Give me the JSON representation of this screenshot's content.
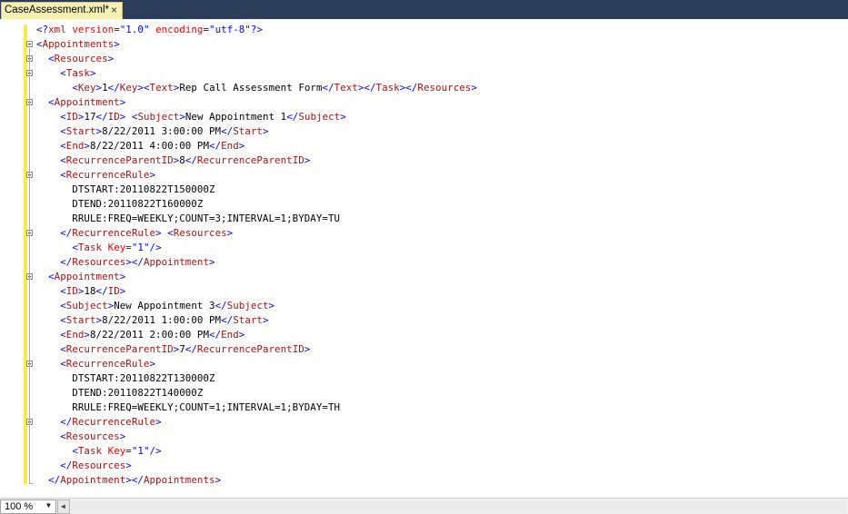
{
  "tab": {
    "title": "CaseAssessment.xml*",
    "close_glyph": "×"
  },
  "status": {
    "zoom": "100 %"
  },
  "icons": {
    "zoom_dropdown": "chevron-down-icon",
    "scroll_left": "scroll-left-icon",
    "tab_close": "close-icon"
  },
  "colors": {
    "tag": "#a31515",
    "delimiter": "#0000ff",
    "attribute": "#ff0000",
    "value": "#0000ff",
    "changed": "#ffe94d",
    "tab_strip": "#2b3c59",
    "active_tab": "#f7f0b5"
  },
  "lines": [
    [
      [
        "d",
        "<?"
      ],
      [
        "t",
        "xml"
      ],
      [
        "x",
        " "
      ],
      [
        "a",
        "version"
      ],
      [
        "d",
        "=\""
      ],
      [
        "v",
        "1.0"
      ],
      [
        "d",
        "\""
      ],
      [
        "x",
        " "
      ],
      [
        "a",
        "encoding"
      ],
      [
        "d",
        "=\""
      ],
      [
        "v",
        "utf-8"
      ],
      [
        "d",
        "\"?>"
      ]
    ],
    [
      [
        "d",
        "<"
      ],
      [
        "t",
        "Appointments"
      ],
      [
        "d",
        ">"
      ]
    ],
    [
      [
        "x",
        "  "
      ],
      [
        "d",
        "<"
      ],
      [
        "t",
        "Resources"
      ],
      [
        "d",
        ">"
      ]
    ],
    [
      [
        "x",
        "    "
      ],
      [
        "d",
        "<"
      ],
      [
        "t",
        "Task"
      ],
      [
        "d",
        ">"
      ]
    ],
    [
      [
        "x",
        "      "
      ],
      [
        "d",
        "<"
      ],
      [
        "t",
        "Key"
      ],
      [
        "d",
        ">"
      ],
      [
        "x",
        "1"
      ],
      [
        "d",
        "</"
      ],
      [
        "t",
        "Key"
      ],
      [
        "d",
        ">"
      ],
      [
        "d",
        "<"
      ],
      [
        "t",
        "Text"
      ],
      [
        "d",
        ">"
      ],
      [
        "x",
        "Rep Call Assessment Form"
      ],
      [
        "d",
        "</"
      ],
      [
        "t",
        "Text"
      ],
      [
        "d",
        ">"
      ],
      [
        "d",
        "</"
      ],
      [
        "t",
        "Task"
      ],
      [
        "d",
        ">"
      ],
      [
        "d",
        "</"
      ],
      [
        "t",
        "Resources"
      ],
      [
        "d",
        ">"
      ]
    ],
    [
      [
        "x",
        "  "
      ],
      [
        "d",
        "<"
      ],
      [
        "t",
        "Appointment"
      ],
      [
        "d",
        ">"
      ]
    ],
    [
      [
        "x",
        "    "
      ],
      [
        "d",
        "<"
      ],
      [
        "t",
        "ID"
      ],
      [
        "d",
        ">"
      ],
      [
        "x",
        "17"
      ],
      [
        "d",
        "</"
      ],
      [
        "t",
        "ID"
      ],
      [
        "d",
        ">"
      ],
      [
        "x",
        " "
      ],
      [
        "d",
        "<"
      ],
      [
        "t",
        "Subject"
      ],
      [
        "d",
        ">"
      ],
      [
        "x",
        "New Appointment 1"
      ],
      [
        "d",
        "</"
      ],
      [
        "t",
        "Subject"
      ],
      [
        "d",
        ">"
      ]
    ],
    [
      [
        "x",
        "    "
      ],
      [
        "d",
        "<"
      ],
      [
        "t",
        "Start"
      ],
      [
        "d",
        ">"
      ],
      [
        "x",
        "8/22/2011 3:00:00 PM"
      ],
      [
        "d",
        "</"
      ],
      [
        "t",
        "Start"
      ],
      [
        "d",
        ">"
      ]
    ],
    [
      [
        "x",
        "    "
      ],
      [
        "d",
        "<"
      ],
      [
        "t",
        "End"
      ],
      [
        "d",
        ">"
      ],
      [
        "x",
        "8/22/2011 4:00:00 PM"
      ],
      [
        "d",
        "</"
      ],
      [
        "t",
        "End"
      ],
      [
        "d",
        ">"
      ]
    ],
    [
      [
        "x",
        "    "
      ],
      [
        "d",
        "<"
      ],
      [
        "t",
        "RecurrenceParentID"
      ],
      [
        "d",
        ">"
      ],
      [
        "x",
        "8"
      ],
      [
        "d",
        "</"
      ],
      [
        "t",
        "RecurrenceParentID"
      ],
      [
        "d",
        ">"
      ]
    ],
    [
      [
        "x",
        "    "
      ],
      [
        "d",
        "<"
      ],
      [
        "t",
        "RecurrenceRule"
      ],
      [
        "d",
        ">"
      ]
    ],
    [
      [
        "x",
        "      DTSTART:20110822T150000Z"
      ]
    ],
    [
      [
        "x",
        "      DTEND:20110822T160000Z"
      ]
    ],
    [
      [
        "x",
        "      RRULE:FREQ=WEEKLY;COUNT=3;INTERVAL=1;BYDAY=TU"
      ]
    ],
    [
      [
        "x",
        "    "
      ],
      [
        "d",
        "</"
      ],
      [
        "t",
        "RecurrenceRule"
      ],
      [
        "d",
        ">"
      ],
      [
        "x",
        " "
      ],
      [
        "d",
        "<"
      ],
      [
        "t",
        "Resources"
      ],
      [
        "d",
        ">"
      ]
    ],
    [
      [
        "x",
        "      "
      ],
      [
        "d",
        "<"
      ],
      [
        "t",
        "Task"
      ],
      [
        "x",
        " "
      ],
      [
        "a",
        "Key"
      ],
      [
        "d",
        "=\""
      ],
      [
        "v",
        "1"
      ],
      [
        "d",
        "\"/>"
      ]
    ],
    [
      [
        "x",
        "    "
      ],
      [
        "d",
        "</"
      ],
      [
        "t",
        "Resources"
      ],
      [
        "d",
        ">"
      ],
      [
        "d",
        "</"
      ],
      [
        "t",
        "Appointment"
      ],
      [
        "d",
        ">"
      ]
    ],
    [
      [
        "x",
        "  "
      ],
      [
        "d",
        "<"
      ],
      [
        "t",
        "Appointment"
      ],
      [
        "d",
        ">"
      ]
    ],
    [
      [
        "x",
        "    "
      ],
      [
        "d",
        "<"
      ],
      [
        "t",
        "ID"
      ],
      [
        "d",
        ">"
      ],
      [
        "x",
        "18"
      ],
      [
        "d",
        "</"
      ],
      [
        "t",
        "ID"
      ],
      [
        "d",
        ">"
      ]
    ],
    [
      [
        "x",
        "    "
      ],
      [
        "d",
        "<"
      ],
      [
        "t",
        "Subject"
      ],
      [
        "d",
        ">"
      ],
      [
        "x",
        "New Appointment 3"
      ],
      [
        "d",
        "</"
      ],
      [
        "t",
        "Subject"
      ],
      [
        "d",
        ">"
      ]
    ],
    [
      [
        "x",
        "    "
      ],
      [
        "d",
        "<"
      ],
      [
        "t",
        "Start"
      ],
      [
        "d",
        ">"
      ],
      [
        "x",
        "8/22/2011 1:00:00 PM"
      ],
      [
        "d",
        "</"
      ],
      [
        "t",
        "Start"
      ],
      [
        "d",
        ">"
      ]
    ],
    [
      [
        "x",
        "    "
      ],
      [
        "d",
        "<"
      ],
      [
        "t",
        "End"
      ],
      [
        "d",
        ">"
      ],
      [
        "x",
        "8/22/2011 2:00:00 PM"
      ],
      [
        "d",
        "</"
      ],
      [
        "t",
        "End"
      ],
      [
        "d",
        ">"
      ]
    ],
    [
      [
        "x",
        "    "
      ],
      [
        "d",
        "<"
      ],
      [
        "t",
        "RecurrenceParentID"
      ],
      [
        "d",
        ">"
      ],
      [
        "x",
        "7"
      ],
      [
        "d",
        "</"
      ],
      [
        "t",
        "RecurrenceParentID"
      ],
      [
        "d",
        ">"
      ]
    ],
    [
      [
        "x",
        "    "
      ],
      [
        "d",
        "<"
      ],
      [
        "t",
        "RecurrenceRule"
      ],
      [
        "d",
        ">"
      ]
    ],
    [
      [
        "x",
        "      DTSTART:20110822T130000Z"
      ]
    ],
    [
      [
        "x",
        "      DTEND:20110822T140000Z"
      ]
    ],
    [
      [
        "x",
        "      RRULE:FREQ=WEEKLY;COUNT=1;INTERVAL=1;BYDAY=TH"
      ]
    ],
    [
      [
        "x",
        "    "
      ],
      [
        "d",
        "</"
      ],
      [
        "t",
        "RecurrenceRule"
      ],
      [
        "d",
        ">"
      ]
    ],
    [
      [
        "x",
        "    "
      ],
      [
        "d",
        "<"
      ],
      [
        "t",
        "Resources"
      ],
      [
        "d",
        ">"
      ]
    ],
    [
      [
        "x",
        "      "
      ],
      [
        "d",
        "<"
      ],
      [
        "t",
        "Task"
      ],
      [
        "x",
        " "
      ],
      [
        "a",
        "Key"
      ],
      [
        "d",
        "=\""
      ],
      [
        "v",
        "1"
      ],
      [
        "d",
        "\"/>"
      ]
    ],
    [
      [
        "x",
        "    "
      ],
      [
        "d",
        "</"
      ],
      [
        "t",
        "Resources"
      ],
      [
        "d",
        ">"
      ]
    ],
    [
      [
        "x",
        "  "
      ],
      [
        "d",
        "</"
      ],
      [
        "t",
        "Appointment"
      ],
      [
        "d",
        ">"
      ],
      [
        "d",
        "</"
      ],
      [
        "t",
        "Appointments"
      ],
      [
        "d",
        ">"
      ]
    ]
  ]
}
